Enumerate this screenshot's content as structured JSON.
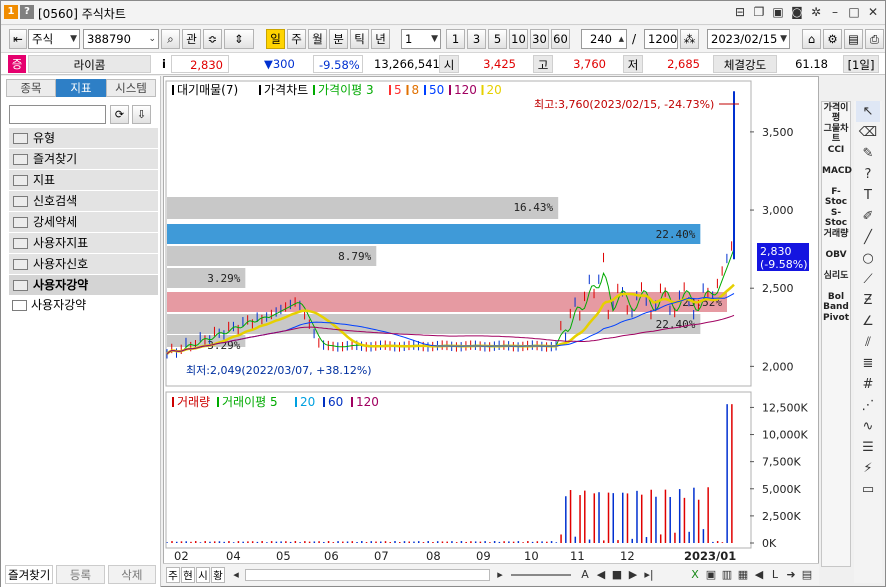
{
  "title": "[0560] 주식차트",
  "toolbar": {
    "market": "주식",
    "code": "388790",
    "search_btn": "관",
    "periods": [
      "일",
      "주",
      "월",
      "분",
      "틱",
      "년"
    ],
    "active_period": "일",
    "period_select": "1",
    "intervals": [
      "1",
      "3",
      "5",
      "10",
      "30",
      "60"
    ],
    "count": "240",
    "divider": "/",
    "total": "1200",
    "date": "2023/02/15"
  },
  "quote": {
    "badge": "증",
    "name": "라이콤",
    "info_btn": "i",
    "price": "2,830",
    "change": "▼300",
    "change_pct": "-9.58%",
    "volume": "13,266,541",
    "open_label": "시",
    "open": "3,425",
    "high_label": "고",
    "high": "3,760",
    "low_label": "저",
    "low": "2,685",
    "strength_label": "체결강도",
    "strength": "61.18",
    "unit_label": "[1일]"
  },
  "left_panel": {
    "tabs": [
      "종목",
      "지표",
      "시스템"
    ],
    "active_tab": "지표",
    "tree": [
      "유형",
      "즐겨찾기",
      "지표",
      "신호검색",
      "강세약세",
      "사용자지표",
      "사용자신호",
      "사용자강약"
    ],
    "sub_item": "사용자강약",
    "footer": [
      "즐겨찾기",
      "등록",
      "삭제"
    ]
  },
  "chart_data": [
    {
      "type": "bar",
      "title": "",
      "legend": [
        {
          "name": "대기매물(7)",
          "color": "#000000"
        },
        {
          "name": "가격차트",
          "color": "#000000"
        },
        {
          "name": "가격이평 3",
          "color": "#00aa00"
        },
        {
          "name": "5",
          "color": "#ff3030"
        },
        {
          "name": "8",
          "color": "#e07000"
        },
        {
          "name": "50",
          "color": "#0040ff"
        },
        {
          "name": "120",
          "color": "#a00060"
        },
        {
          "name": "20",
          "color": "#e6d000"
        }
      ],
      "ylim": [
        1900,
        3800
      ],
      "ytick_labels": [
        "3,500",
        "3,000",
        "2,500",
        "2,000"
      ],
      "yticks": [
        3500,
        3000,
        2500,
        2000
      ],
      "overhang_profile": [
        {
          "label": "16.43%",
          "value": 16.43,
          "color": "#c8c8c8"
        },
        {
          "label": "22.40%",
          "value": 22.4,
          "color": "#3f9ad8"
        },
        {
          "label": "8.79%",
          "value": 8.79,
          "color": "#c8c8c8"
        },
        {
          "label": "3.29%",
          "value": 3.29,
          "color": "#c8c8c8"
        },
        {
          "label": "23.52%",
          "value": 23.52,
          "color": "#e69aa2"
        },
        {
          "label": "22.40%",
          "value": 22.4,
          "color": "#c8c8c8"
        },
        {
          "label": "3.29%",
          "value": 3.29,
          "color": "#c8c8c8"
        }
      ],
      "max_annotation": "최고:3,760(2023/02/15, -24.73%)",
      "min_annotation": "최저:2,049(2022/03/07, +38.12%)",
      "last_price_tag": [
        "2,830",
        "(-9.58%)"
      ],
      "xtick_labels": [
        "02",
        "04",
        "05",
        "06",
        "07",
        "08",
        "09",
        "10",
        "11",
        "12",
        "2023/01"
      ]
    },
    {
      "type": "bar",
      "title": "",
      "legend": [
        {
          "name": "거래량",
          "color": "#cc0000"
        },
        {
          "name": "거래이평 5",
          "color": "#00aa00"
        },
        {
          "name": "20",
          "color": "#00a0e0"
        },
        {
          "name": "60",
          "color": "#0030c0"
        },
        {
          "name": "120",
          "color": "#a00060"
        }
      ],
      "ylim": [
        0,
        13000000
      ],
      "ytick_labels": [
        "12,500K",
        "10,000K",
        "7,500K",
        "5,000K",
        "2,500K",
        "0K"
      ],
      "yticks": [
        12500000,
        10000000,
        7500000,
        5000000,
        2500000,
        0
      ]
    }
  ],
  "right_sidebar": [
    "가격이평",
    "그물차트",
    "CCI",
    "MACD",
    "F-Stoc",
    "S-Stoc",
    "거래량",
    "OBV",
    "심리도",
    "Bol Band",
    "Pivot"
  ],
  "bottom_tabs": [
    "주",
    "현",
    "시",
    "황"
  ]
}
